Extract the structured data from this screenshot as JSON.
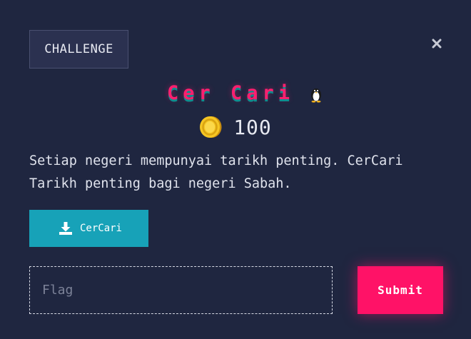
{
  "modal": {
    "tab_label": "CHALLENGE",
    "close_icon": "close-icon"
  },
  "challenge": {
    "title": "Cer Cari",
    "category_icon": "penguin-icon",
    "points_icon": "coin-icon",
    "points": "100",
    "description": "Setiap negeri mempunyai tarikh penting. CerCari Tarikh penting bagi negeri Sabah."
  },
  "file": {
    "icon": "download-icon",
    "label": "CerCari"
  },
  "submission": {
    "input_value": "",
    "input_placeholder": "Flag",
    "submit_label": "Submit"
  },
  "colors": {
    "background": "#1f2640",
    "title": "#ff1f6f",
    "title_shadow": "#0e8f8f",
    "download_button": "#17a2b8",
    "submit_button": "#ff1267",
    "coin": "#f5c623"
  }
}
